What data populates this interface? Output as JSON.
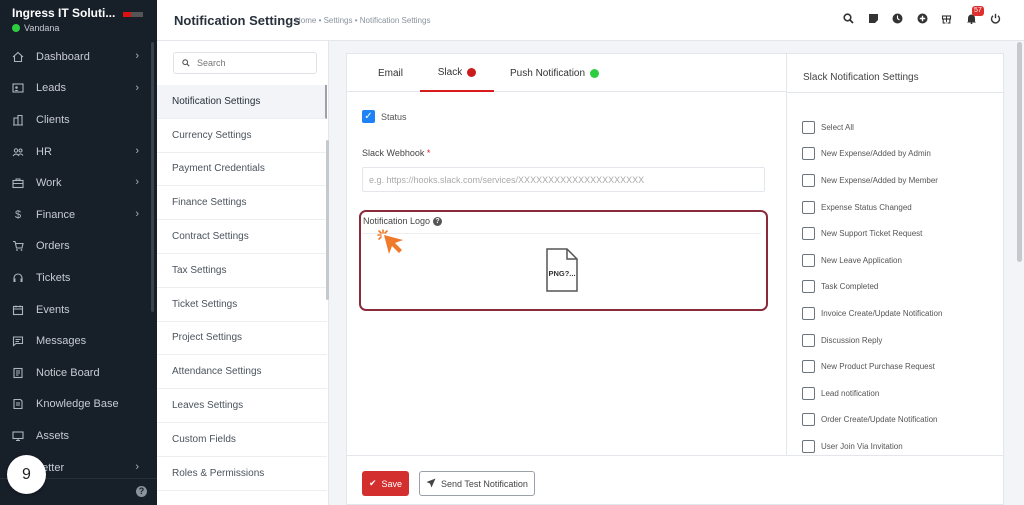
{
  "sidebar": {
    "company": "Ingress IT Soluti...",
    "user": "Vandana",
    "items": [
      {
        "label": "Dashboard",
        "icon": "home-icon",
        "has_children": true
      },
      {
        "label": "Leads",
        "icon": "id-card-icon",
        "has_children": true
      },
      {
        "label": "Clients",
        "icon": "building-icon",
        "has_children": false
      },
      {
        "label": "HR",
        "icon": "people-icon",
        "has_children": true
      },
      {
        "label": "Work",
        "icon": "briefcase-icon",
        "has_children": true
      },
      {
        "label": "Finance",
        "icon": "dollar-icon",
        "has_children": true
      },
      {
        "label": "Orders",
        "icon": "cart-icon",
        "has_children": false
      },
      {
        "label": "Tickets",
        "icon": "headset-icon",
        "has_children": false
      },
      {
        "label": "Events",
        "icon": "calendar-icon",
        "has_children": false
      },
      {
        "label": "Messages",
        "icon": "chat-icon",
        "has_children": false
      },
      {
        "label": "Notice Board",
        "icon": "notice-icon",
        "has_children": false
      },
      {
        "label": "Knowledge Base",
        "icon": "book-icon",
        "has_children": false
      },
      {
        "label": "Assets",
        "icon": "monitor-icon",
        "has_children": false
      },
      {
        "label": "Letter",
        "icon": "letter-icon",
        "has_children": true
      }
    ],
    "step_badge": "9"
  },
  "topbar": {
    "title": "Notification Settings",
    "breadcrumb": "Home • Settings • Notification Settings",
    "notification_count": "57"
  },
  "settings_menu": {
    "search_placeholder": "Search",
    "items": [
      "Notification Settings",
      "Currency Settings",
      "Payment Credentials",
      "Finance Settings",
      "Contract Settings",
      "Tax Settings",
      "Ticket Settings",
      "Project Settings",
      "Attendance Settings",
      "Leaves Settings",
      "Custom Fields",
      "Roles & Permissions"
    ],
    "active_index": 0
  },
  "tabs": [
    {
      "label": "Email",
      "dot_color": null,
      "active": false
    },
    {
      "label": "Slack",
      "dot_color": "#cc1b1b",
      "active": true
    },
    {
      "label": "Push Notification",
      "dot_color": "#2ecc40",
      "active": false
    }
  ],
  "form": {
    "status_label": "Status",
    "status_checked": true,
    "webhook_label": "Slack Webhook",
    "webhook_required": "*",
    "webhook_placeholder": "e.g. https://hooks.slack.com/services/XXXXXXXXXXXXXXXXXXXXX",
    "logo_label": "Notification Logo",
    "file_icon_text": "PNG?..."
  },
  "buttons": {
    "save": "Save",
    "send_test": "Send Test Notification"
  },
  "slack_settings": {
    "title": "Slack Notification Settings",
    "options": [
      "Select All",
      "New Expense/Added by Admin",
      "New Expense/Added by Member",
      "Expense Status Changed",
      "New Support Ticket Request",
      "New Leave Application",
      "Task Completed",
      "Invoice Create/Update Notification",
      "Discussion Reply",
      "New Product Purchase Request",
      "Lead notification",
      "Order Create/Update Notification",
      "User Join Via Invitation"
    ]
  },
  "colors": {
    "sidebar_bg": "#171f29",
    "accent_red": "#d32f2f",
    "checkbox_blue": "#1d82f5",
    "highlight_border": "#8a2b3c",
    "cursor_orange": "#f07a2a"
  }
}
